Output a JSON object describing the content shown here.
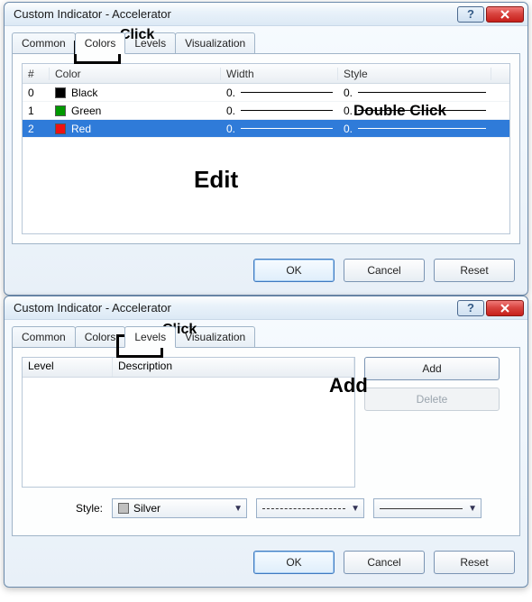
{
  "d1": {
    "title": "Custom Indicator - Accelerator",
    "tabs": [
      "Common",
      "Colors",
      "Levels",
      "Visualization"
    ],
    "active_tab": "Colors",
    "columns": {
      "idx": "#",
      "color": "Color",
      "width": "Width",
      "style": "Style"
    },
    "rows": [
      {
        "idx": "0",
        "color_name": "Black",
        "color_hex": "#000000",
        "width": "0.",
        "style": "0."
      },
      {
        "idx": "1",
        "color_name": "Green",
        "color_hex": "#009900",
        "width": "0.",
        "style": "0."
      },
      {
        "idx": "2",
        "color_name": "Red",
        "color_hex": "#e11",
        "width": "0.",
        "style": "0."
      }
    ],
    "selected_row": 2,
    "ok": "OK",
    "cancel": "Cancel",
    "reset": "Reset",
    "anno_click": "Click",
    "anno_dblclick": "Double Click",
    "anno_edit": "Edit"
  },
  "d2": {
    "title": "Custom Indicator - Accelerator",
    "tabs": [
      "Common",
      "Colors",
      "Levels",
      "Visualization"
    ],
    "active_tab": "Levels",
    "columns": {
      "level": "Level",
      "desc": "Description"
    },
    "add": "Add",
    "delete": "Delete",
    "style_label": "Style:",
    "style_color_name": "Silver",
    "ok": "OK",
    "cancel": "Cancel",
    "reset": "Reset",
    "anno_click": "Click",
    "anno_add": "Add"
  }
}
